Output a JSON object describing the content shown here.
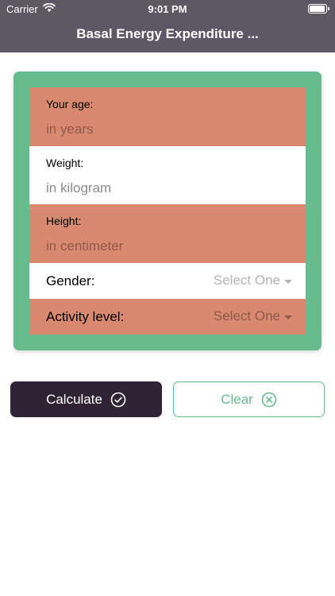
{
  "status_bar": {
    "carrier": "Carrier",
    "time": "9:01 PM"
  },
  "nav": {
    "title": "Basal Energy Expenditure ..."
  },
  "form": {
    "age": {
      "label": "Your age:",
      "placeholder": "in years"
    },
    "weight": {
      "label": "Weight:",
      "placeholder": "in kilogram"
    },
    "height": {
      "label": "Height:",
      "placeholder": "in centimeter"
    },
    "gender": {
      "label": "Gender:",
      "value": "Select One"
    },
    "activity": {
      "label": "Activity level:",
      "value": "Select One"
    }
  },
  "buttons": {
    "calculate": "Calculate",
    "clear": "Clear"
  },
  "colors": {
    "nav_bg": "#5d5766",
    "card_bg": "#66bb8f",
    "row_salmon": "#d98970",
    "calc_bg": "#312236",
    "clear_accent": "#66bb8f"
  },
  "icons": {
    "wifi": "wifi-icon",
    "battery": "battery-icon",
    "calculate": "check-circle-icon",
    "clear": "x-circle-icon",
    "dropdown": "caret-down-icon"
  }
}
